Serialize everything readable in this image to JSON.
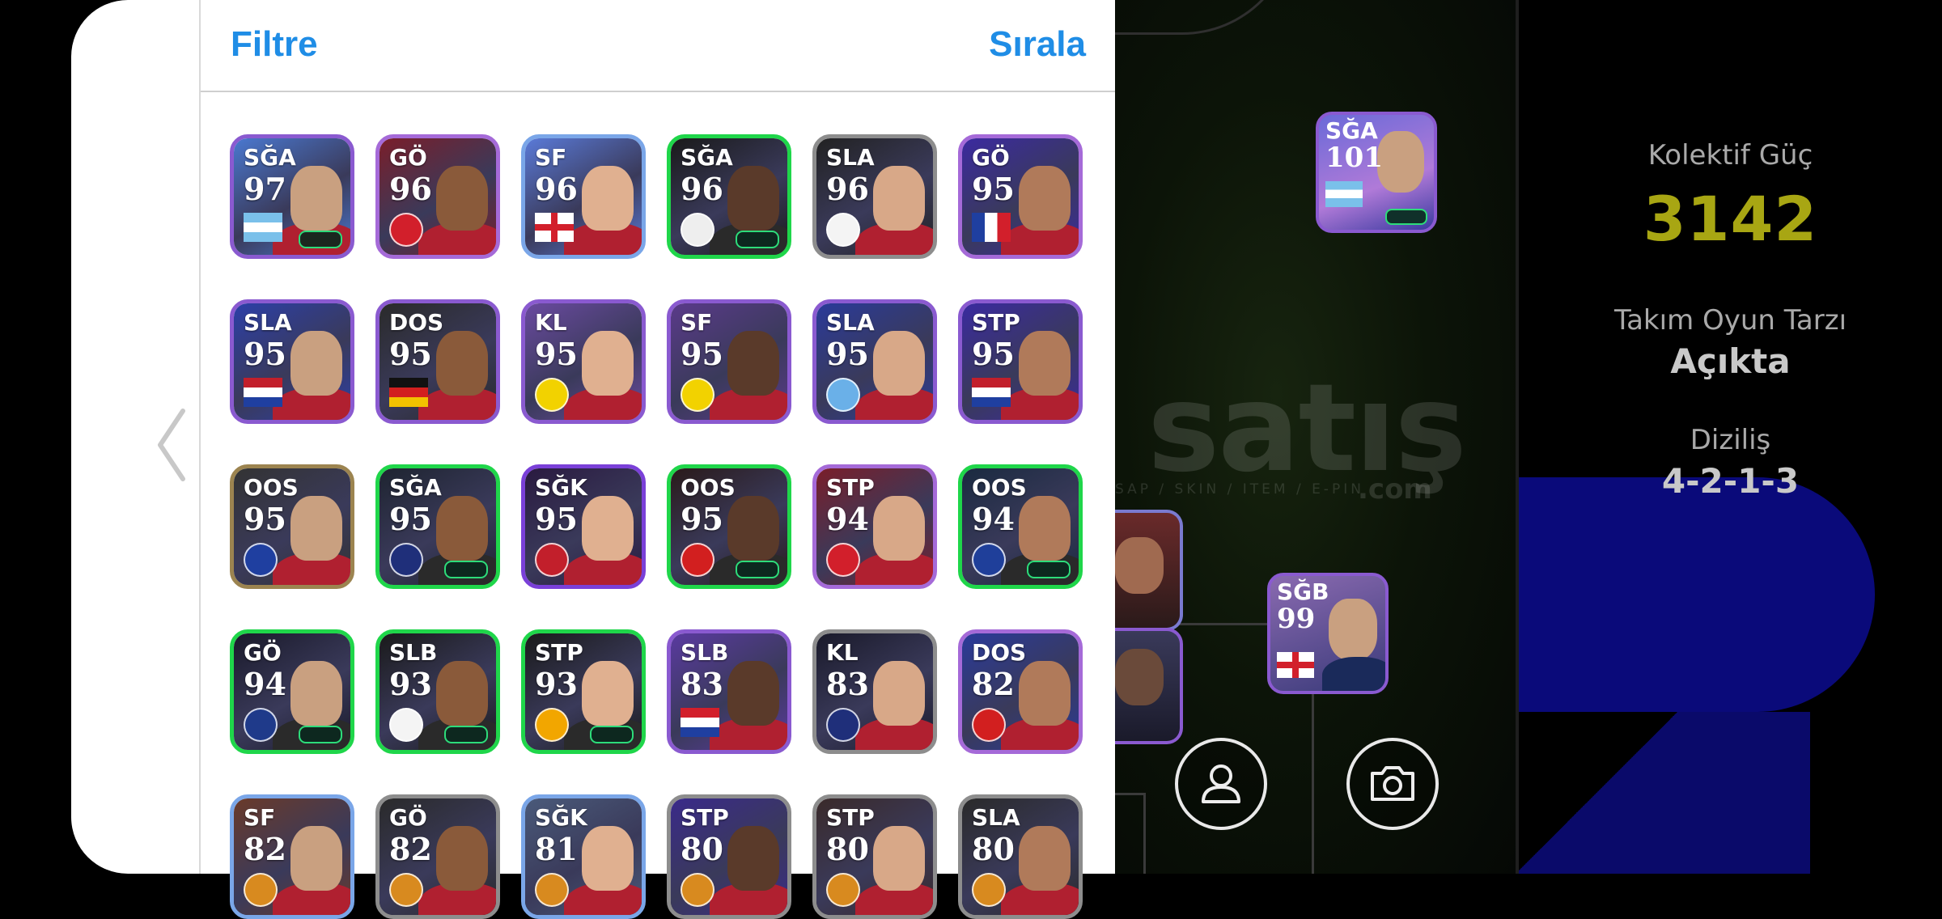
{
  "header": {
    "filter_label": "Filtre",
    "sort_label": "Sırala"
  },
  "players": [
    {
      "pos": "SĞA",
      "rating": "97",
      "border": "#8a5ad0",
      "bg": "#4a78d0",
      "badge": "flag-argentina"
    },
    {
      "pos": "GÖ",
      "rating": "96",
      "border": "#a56ad8",
      "bg": "#7a1e2a",
      "badge": "club-arsenal"
    },
    {
      "pos": "SF",
      "rating": "96",
      "border": "#7aa6e8",
      "bg": "#5a7ad8",
      "badge": "flag-england"
    },
    {
      "pos": "SĞA",
      "rating": "96",
      "border": "#1fd64a",
      "bg": "#1a1a1a",
      "badge": "club-saopaulo"
    },
    {
      "pos": "SLA",
      "rating": "96",
      "border": "#8d8d8d",
      "bg": "#222",
      "badge": "club-realmadrid"
    },
    {
      "pos": "GÖ",
      "rating": "95",
      "border": "#a56ad8",
      "bg": "#3b2aa0",
      "badge": "flag-france"
    },
    {
      "pos": "SLA",
      "rating": "95",
      "border": "#8a5ad0",
      "bg": "#2c3fa8",
      "badge": "flag-netherlands"
    },
    {
      "pos": "DOS",
      "rating": "95",
      "border": "#8a5ad0",
      "bg": "#2a2a2a",
      "badge": "flag-germany"
    },
    {
      "pos": "KL",
      "rating": "95",
      "border": "#8a5ad0",
      "bg": "#6a4aa0",
      "badge": "club-dortmund"
    },
    {
      "pos": "SF",
      "rating": "95",
      "border": "#8a5ad0",
      "bg": "#5a3a8a",
      "badge": "club-dortmund"
    },
    {
      "pos": "SLA",
      "rating": "95",
      "border": "#8a5ad0",
      "bg": "#2a3a9a",
      "badge": "club-mancity"
    },
    {
      "pos": "STP",
      "rating": "95",
      "border": "#8a5ad0",
      "bg": "#3a2aa0",
      "badge": "flag-netherlands"
    },
    {
      "pos": "OOS",
      "rating": "95",
      "border": "#9c8450",
      "bg": "#333",
      "badge": "club-chelsea"
    },
    {
      "pos": "SĞA",
      "rating": "95",
      "border": "#1fd64a",
      "bg": "#1e2430",
      "badge": "club-psg"
    },
    {
      "pos": "SĞK",
      "rating": "95",
      "border": "#7a40d8",
      "bg": "#2a1a40",
      "badge": "club-alahly"
    },
    {
      "pos": "OOS",
      "rating": "95",
      "border": "#1fd64a",
      "bg": "#2a1a1a",
      "badge": "club-manutd"
    },
    {
      "pos": "STP",
      "rating": "94",
      "border": "#a56ad8",
      "bg": "#7a1e2a",
      "badge": "club-arsenal"
    },
    {
      "pos": "OOS",
      "rating": "94",
      "border": "#1fd64a",
      "bg": "#1a2a40",
      "badge": "club-leicester"
    },
    {
      "pos": "GÖ",
      "rating": "94",
      "border": "#1fd64a",
      "bg": "#1a1a2a",
      "badge": "club-atalanta"
    },
    {
      "pos": "SLB",
      "rating": "93",
      "border": "#1fd64a",
      "bg": "#1a1a1a",
      "badge": "club-tottenham"
    },
    {
      "pos": "STP",
      "rating": "93",
      "border": "#1fd64a",
      "bg": "#1a1a1a",
      "badge": "club-wolves"
    },
    {
      "pos": "SLB",
      "rating": "83",
      "border": "#8a5ad0",
      "bg": "#5a3aa0",
      "badge": "flag-croatia"
    },
    {
      "pos": "KL",
      "rating": "83",
      "border": "#8d8d8d",
      "bg": "#1a1a2a",
      "badge": "club-psg"
    },
    {
      "pos": "DOS",
      "rating": "82",
      "border": "#a56ad8",
      "bg": "#2a3a9a",
      "badge": "club-manutd"
    },
    {
      "pos": "SF",
      "rating": "82",
      "border": "#7aa6e8",
      "bg": "#6a3a2a",
      "badge": "club-generic"
    },
    {
      "pos": "GÖ",
      "rating": "82",
      "border": "#8d8d8d",
      "bg": "#2a2a2a",
      "badge": "club-generic"
    },
    {
      "pos": "SĞK",
      "rating": "81",
      "border": "#7aa6e8",
      "bg": "#4a5a7a",
      "badge": "club-generic"
    },
    {
      "pos": "STP",
      "rating": "80",
      "border": "#8d8d8d",
      "bg": "#3a2a8a",
      "badge": "club-generic"
    },
    {
      "pos": "STP",
      "rating": "80",
      "border": "#8d8d8d",
      "bg": "#3a2a2a",
      "badge": "club-generic"
    },
    {
      "pos": "SLA",
      "rating": "80",
      "border": "#8d8d8d",
      "bg": "#2a2a2a",
      "badge": "club-generic"
    }
  ],
  "pitch_cards": [
    {
      "pos": "SĞA",
      "rating": "101",
      "badge": "flag-argentina"
    },
    {
      "pos": "SĞB",
      "rating": "99",
      "badge": "flag-england"
    }
  ],
  "watermark": {
    "text": "satış",
    "sub": "SAP / SKIN / ITEM / E-PIN",
    "com": ".com"
  },
  "stats": {
    "power_label": "Kolektif Güç",
    "power_value": "3142",
    "playstyle_label": "Takım Oyun Tarzı",
    "playstyle_value": "Açıkta",
    "formation_label": "Diziliş",
    "formation_value": "4-2-1-3"
  },
  "icons": [
    "chevron-left-icon",
    "user-icon",
    "camera-icon"
  ],
  "colors": {
    "accent_blue": "#1f8de6",
    "power_yellow": "#a8a613",
    "boost_green": "#1fd64a"
  }
}
